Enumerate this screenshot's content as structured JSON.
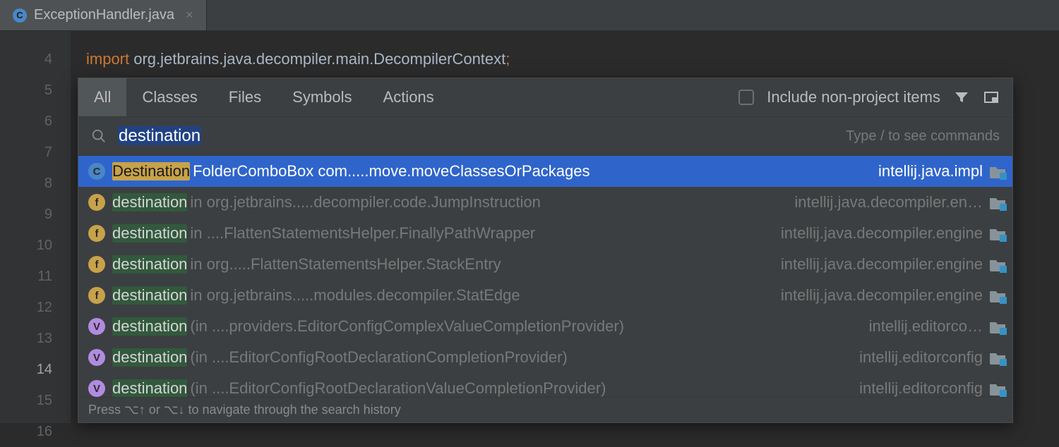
{
  "tab": {
    "title": "ExceptionHandler.java",
    "icon_letter": "C"
  },
  "gutter": {
    "lines": [
      "4",
      "5",
      "6",
      "7",
      "8",
      "9",
      "10",
      "11",
      "12",
      "13",
      "14",
      "15",
      "16"
    ],
    "current_index": 10
  },
  "code": {
    "keyword": "import",
    "text": " org.jetbrains.java.decompiler.main.DecompilerContext",
    "semicolon": ";"
  },
  "search": {
    "tabs": [
      "All",
      "Classes",
      "Files",
      "Symbols",
      "Actions"
    ],
    "active_tab": 0,
    "include_label": "Include non-project items",
    "query": "destination",
    "hint": "Type / to see commands",
    "footer": "Press ⌥↑ or ⌥↓ to navigate through the search history",
    "results": [
      {
        "kind": "class",
        "match": "Destination",
        "suffix": "FolderComboBox com.....move.moveClassesOrPackages",
        "module": "intellij.java.impl",
        "selected": true
      },
      {
        "kind": "field",
        "match": "destination",
        "location": "in org.jetbrains.....decompiler.code.JumpInstruction",
        "module": "intellij.java.decompiler.en…"
      },
      {
        "kind": "field",
        "match": "destination",
        "location": "in ....FlattenStatementsHelper.FinallyPathWrapper",
        "module": "intellij.java.decompiler.engine"
      },
      {
        "kind": "field",
        "match": "destination",
        "location": "in org.....FlattenStatementsHelper.StackEntry",
        "module": "intellij.java.decompiler.engine"
      },
      {
        "kind": "field",
        "match": "destination",
        "location": "in org.jetbrains.....modules.decompiler.StatEdge",
        "module": "intellij.java.decompiler.engine"
      },
      {
        "kind": "var",
        "match": "destination",
        "location": "(in ....providers.EditorConfigComplexValueCompletionProvider)",
        "module": "intellij.editorco…"
      },
      {
        "kind": "var",
        "match": "destination",
        "location": "(in ....EditorConfigRootDeclarationCompletionProvider)",
        "module": "intellij.editorconfig"
      },
      {
        "kind": "var",
        "match": "destination",
        "location": "(in ....EditorConfigRootDeclarationValueCompletionProvider)",
        "module": "intellij.editorconfig"
      }
    ]
  }
}
